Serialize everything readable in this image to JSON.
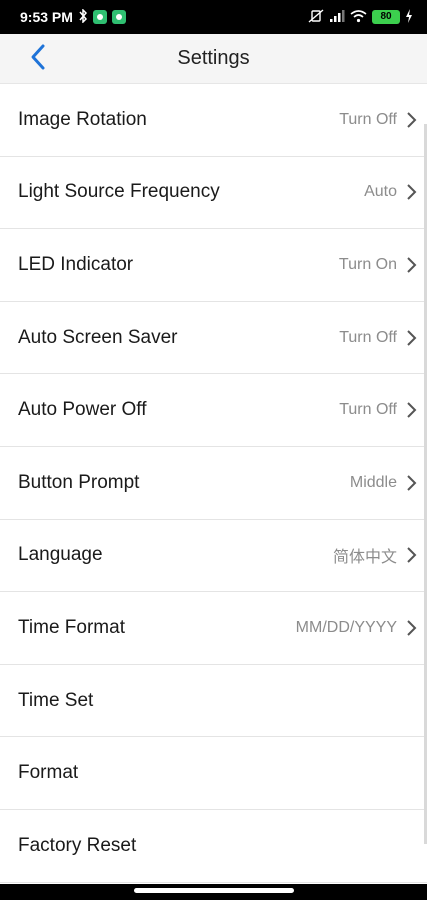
{
  "status_bar": {
    "time": "9:53 PM",
    "battery": "80"
  },
  "header": {
    "title": "Settings",
    "back_icon": "chevron-left-icon"
  },
  "colors": {
    "accent": "#1e73d8",
    "chevron": "#555555"
  },
  "settings": [
    {
      "label": "Image Rotation",
      "value": "Turn Off"
    },
    {
      "label": "Light Source Frequency",
      "value": "Auto"
    },
    {
      "label": "LED Indicator",
      "value": "Turn On"
    },
    {
      "label": "Auto Screen Saver",
      "value": "Turn Off"
    },
    {
      "label": "Auto Power Off",
      "value": "Turn Off"
    },
    {
      "label": "Button Prompt",
      "value": "Middle"
    },
    {
      "label": "Language",
      "value": "简体中文"
    },
    {
      "label": "Time Format",
      "value": "MM/DD/YYYY"
    },
    {
      "label": "Time Set",
      "value": ""
    },
    {
      "label": "Format",
      "value": ""
    },
    {
      "label": "Factory Reset",
      "value": ""
    }
  ]
}
